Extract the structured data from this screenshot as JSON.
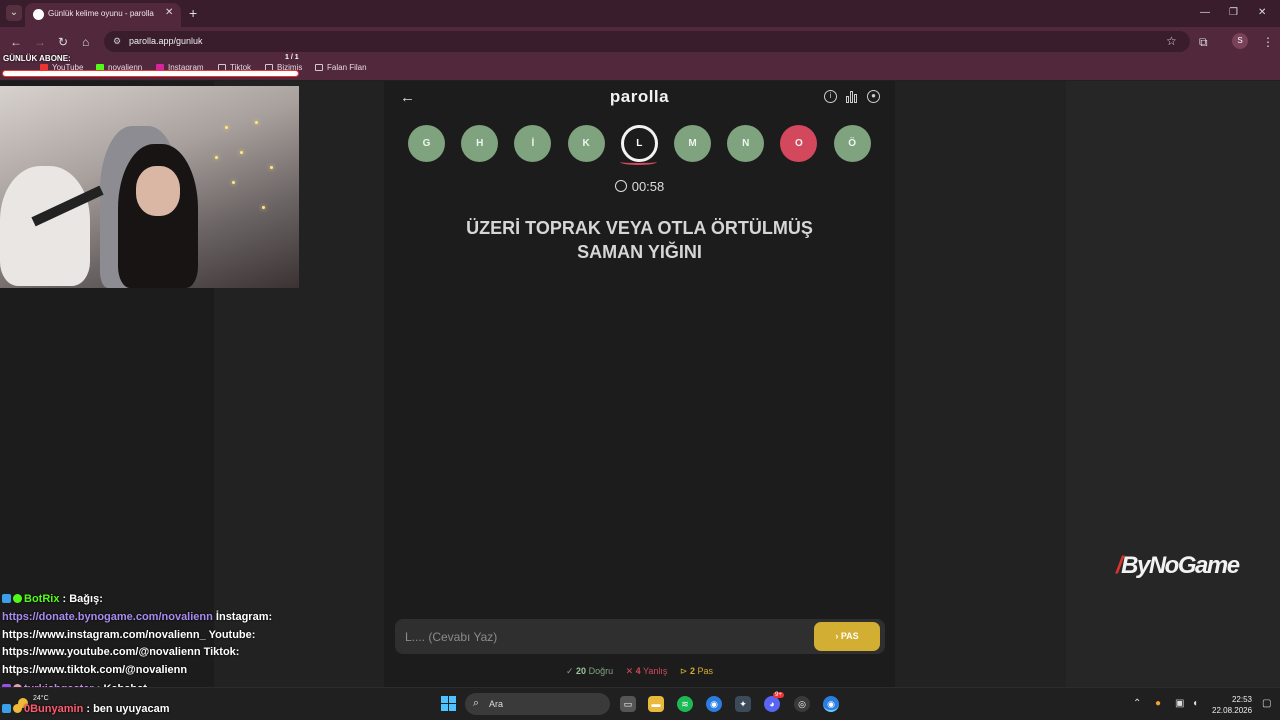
{
  "browser": {
    "tab_title": "Günlük kelime oyunu - parolla",
    "url": "parolla.app/gunluk",
    "profile_initial": "S",
    "bookmarks": [
      "YouTube",
      "novalienn",
      "Instagram",
      "Tiktok",
      "Bizimis",
      "Falan Filan"
    ]
  },
  "overlay": {
    "title": "GÜNLÜK ABONE:",
    "count": "1 / 1"
  },
  "app": {
    "title": "parolla",
    "letters": [
      {
        "char": "G",
        "state": "correct"
      },
      {
        "char": "H",
        "state": "correct"
      },
      {
        "char": "İ",
        "state": "correct"
      },
      {
        "char": "K",
        "state": "correct"
      },
      {
        "char": "L",
        "state": "current"
      },
      {
        "char": "M",
        "state": "correct"
      },
      {
        "char": "N",
        "state": "correct"
      },
      {
        "char": "O",
        "state": "wrong"
      },
      {
        "char": "Ö",
        "state": "correct"
      }
    ],
    "timer": "00:58",
    "question_line1": "ÜZERİ TOPRAK VEYA OTLA ÖRTÜLMÜŞ",
    "question_line2": "SAMAN YIĞINI",
    "answer_placeholder": "L.... (Cevabı Yaz)",
    "pass_label": "PAS",
    "stats": {
      "correct_count": "20",
      "correct_label": "Doğru",
      "wrong_count": "4",
      "wrong_label": "Yanlış",
      "pass_count": "2",
      "pass_label": "Pas"
    },
    "colors": {
      "correct": "#7fa27f",
      "wrong": "#d4485e",
      "pass": "#d2ae32"
    }
  },
  "chat": {
    "line1_user": "BotRix",
    "line1_text": ": Bağış:",
    "line2_link": "https://donate.bynogame.com/novalienn",
    "line2_text": " İnstagram:",
    "line3_text": "https://www.instagram.com/novalienn_ Youtube:",
    "line4_text": "https://www.youtube.com/@novalienn Tiktok:",
    "line5_text": "https://www.tiktok.com/@novalienn",
    "line6_user": "turkishgaster",
    "line6_text": ": Kabahat",
    "line7_user": "0Bunyamin",
    "line7_text": ": ben uyuyacam"
  },
  "watermark": {
    "brand": "ByNoGame"
  },
  "taskbar": {
    "weather": "24°C",
    "search_placeholder": "Ara",
    "time": "22:53",
    "date": "22.08.2026",
    "notification_badge": "9+"
  }
}
